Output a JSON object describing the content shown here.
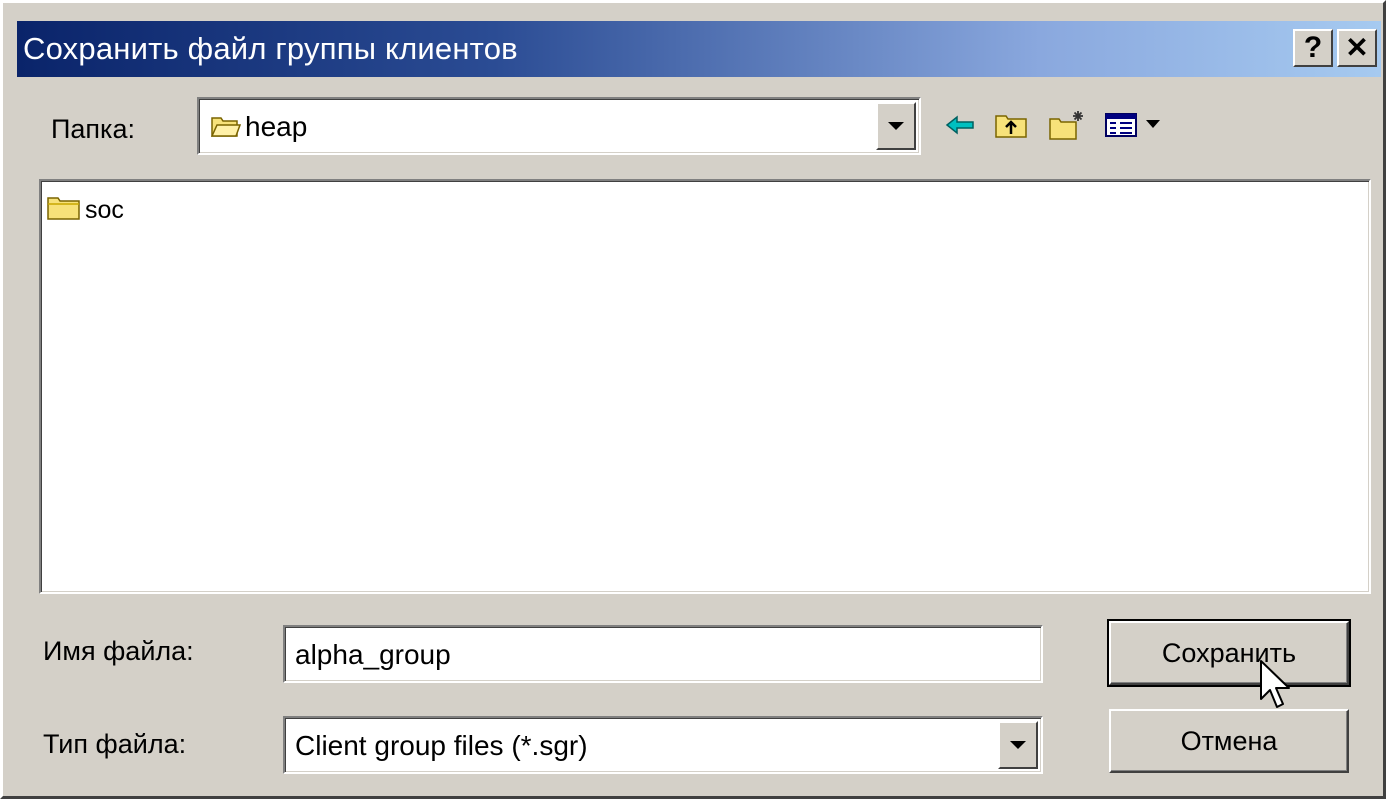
{
  "window": {
    "title": "Сохранить файл группы клиентов",
    "help_glyph": "?",
    "close_glyph": "✕"
  },
  "folder_bar": {
    "label": "Папка:",
    "current_folder": "heap",
    "icons": [
      "back-icon",
      "up-folder-icon",
      "new-folder-icon",
      "view-menu-icon"
    ]
  },
  "file_list": {
    "items": [
      {
        "name": "soc",
        "icon": "folder-icon"
      }
    ]
  },
  "filename": {
    "label": "Имя файла:",
    "value": "alpha_group"
  },
  "filetype": {
    "label": "Тип файла:",
    "selected": "Client group files (*.sgr)"
  },
  "buttons": {
    "save": "Сохранить",
    "cancel": "Отмена"
  },
  "colors": {
    "title_start": "#0a246a",
    "title_end": "#a6caf0",
    "face": "#d4d0c8"
  }
}
